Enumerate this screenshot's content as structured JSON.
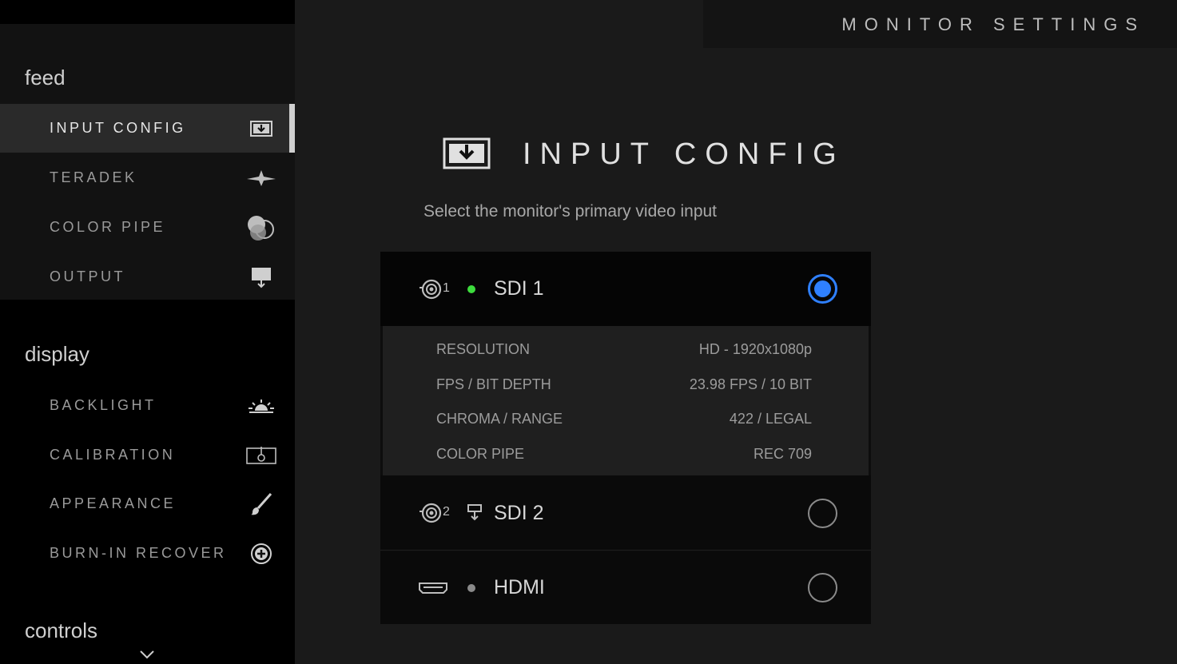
{
  "header": {
    "title": "MONITOR SETTINGS"
  },
  "sidebar": {
    "groups": [
      {
        "label": "feed"
      },
      {
        "label": "display"
      },
      {
        "label": "controls"
      }
    ],
    "feed_items": [
      {
        "label": "INPUT CONFIG",
        "icon": "input-config-icon",
        "active": true
      },
      {
        "label": "TERADEK",
        "icon": "teradek-icon"
      },
      {
        "label": "COLOR PIPE",
        "icon": "color-pipe-icon"
      },
      {
        "label": "OUTPUT",
        "icon": "output-icon"
      }
    ],
    "display_items": [
      {
        "label": "BACKLIGHT",
        "icon": "backlight-icon"
      },
      {
        "label": "CALIBRATION",
        "icon": "calibration-icon"
      },
      {
        "label": "APPEARANCE",
        "icon": "brush-icon"
      },
      {
        "label": "BURN-IN RECOVER",
        "icon": "plus-circle-icon"
      }
    ]
  },
  "main": {
    "title": "INPUT CONFIG",
    "subtitle": "Select the monitor's primary video input",
    "sources": [
      {
        "label": "SDI 1",
        "port_number": "1",
        "status": "active",
        "selected": true
      },
      {
        "label": "SDI 2",
        "port_number": "2",
        "status": "pass-through",
        "selected": false
      },
      {
        "label": "HDMI",
        "status": "inactive",
        "selected": false
      }
    ],
    "details": [
      {
        "key": "RESOLUTION",
        "value": "HD - 1920x1080p"
      },
      {
        "key": "FPS / BIT DEPTH",
        "value": "23.98 FPS / 10 BIT"
      },
      {
        "key": "CHROMA / RANGE",
        "value": "422 / LEGAL"
      },
      {
        "key": "COLOR PIPE",
        "value": "REC 709"
      }
    ]
  },
  "colors": {
    "accent": "#2f80ff",
    "status_active": "#3ddc3d",
    "status_inactive": "#8a8a8a"
  }
}
